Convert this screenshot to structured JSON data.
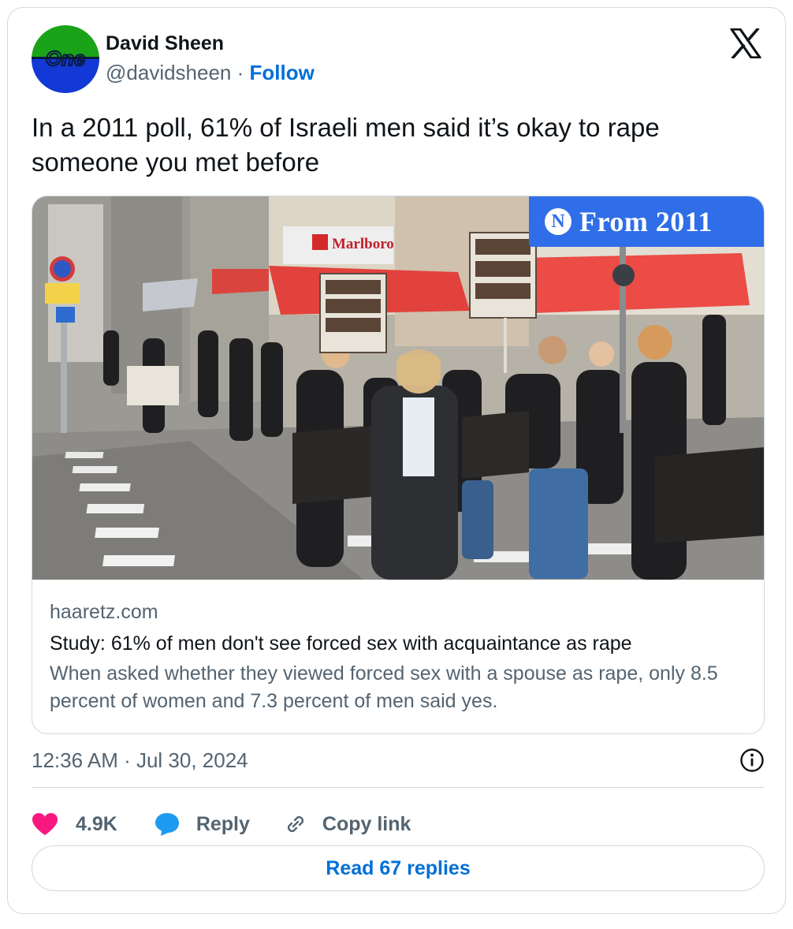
{
  "author": {
    "name": "David Sheen",
    "handle": "@davidsheen",
    "separator": "·",
    "follow_label": "Follow",
    "avatar_text": "One",
    "avatar_colors": {
      "top": "#1aa319",
      "bottom": "#1238d6",
      "text": "#0b1a3c"
    }
  },
  "brand_icon": "x-logo-icon",
  "tweet": {
    "text": "In a 2011 poll, 61% of Israeli men said it’s okay to rape someone you met before"
  },
  "link_card": {
    "badge_text": "From 2011",
    "badge_icon": "haaretz-logo-icon",
    "badge_color": "#2f6ee8",
    "photo_signs": {
      "storefront": "Marlboro"
    },
    "domain": "haaretz.com",
    "title": "Study: 61% of men don't see forced sex with acquaintance as rape",
    "description": "When asked whether they viewed forced sex with a spouse as rape, only 8.5 percent of women and 7.3 percent of men said yes."
  },
  "meta": {
    "timestamp": "12:36 AM · Jul 30, 2024",
    "info_icon": "info-icon"
  },
  "actions": {
    "like_count": "4.9K",
    "reply_label": "Reply",
    "copy_label": "Copy link"
  },
  "read_replies_label": "Read 67 replies",
  "colors": {
    "link_blue": "#006fd6",
    "like_pink": "#f91880",
    "reply_blue": "#1d9bf0",
    "secondary_text": "#536471",
    "border": "#cfd9de"
  }
}
